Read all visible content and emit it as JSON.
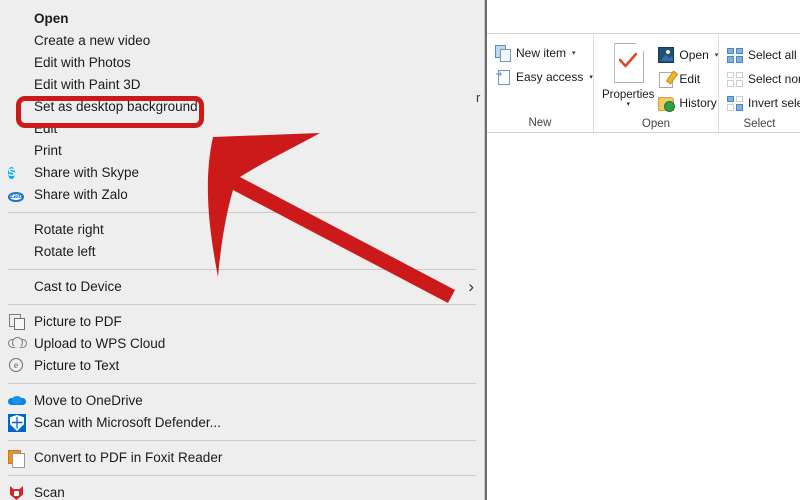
{
  "window": {
    "background_color": "#ffffff",
    "menu_background": "#eeeeee",
    "accent_red": "#cc1a1a",
    "partial_text_right_of_menu": "r"
  },
  "context_menu": {
    "name": "file-context-menu",
    "groups": [
      {
        "items": [
          {
            "label": "Open",
            "icon": "none",
            "bold": true,
            "has_submenu": false
          },
          {
            "label": "Create a new video",
            "icon": "none",
            "bold": false,
            "has_submenu": false
          },
          {
            "label": "Edit with Photos",
            "icon": "none",
            "bold": false,
            "has_submenu": false
          },
          {
            "label": "Edit with Paint 3D",
            "icon": "none",
            "bold": false,
            "has_submenu": false
          },
          {
            "label": "Set as desktop background",
            "icon": "none",
            "bold": false,
            "has_submenu": false,
            "highlighted": true
          },
          {
            "label": "Edit",
            "icon": "none",
            "bold": false,
            "has_submenu": false
          },
          {
            "label": "Print",
            "icon": "none",
            "bold": false,
            "has_submenu": false
          },
          {
            "label": "Share with Skype",
            "icon": "skype-icon",
            "bold": false,
            "has_submenu": false
          },
          {
            "label": "Share with Zalo",
            "icon": "zalo-icon",
            "bold": false,
            "has_submenu": false
          }
        ]
      },
      {
        "items": [
          {
            "label": "Rotate right",
            "icon": "none",
            "bold": false,
            "has_submenu": false
          },
          {
            "label": "Rotate left",
            "icon": "none",
            "bold": false,
            "has_submenu": false
          }
        ]
      },
      {
        "items": [
          {
            "label": "Cast to Device",
            "icon": "none",
            "bold": false,
            "has_submenu": true,
            "submenu_glyph": "›"
          }
        ]
      },
      {
        "items": [
          {
            "label": "Picture to PDF",
            "icon": "picture-to-pdf-icon",
            "bold": false,
            "has_submenu": false
          },
          {
            "label": "Upload to WPS Cloud",
            "icon": "cloud-upload-icon",
            "bold": false,
            "has_submenu": false
          },
          {
            "label": "Picture to Text",
            "icon": "picture-to-text-icon",
            "bold": false,
            "has_submenu": false
          }
        ]
      },
      {
        "items": [
          {
            "label": "Move to OneDrive",
            "icon": "onedrive-icon",
            "bold": false,
            "has_submenu": false
          },
          {
            "label": "Scan with Microsoft Defender...",
            "icon": "defender-shield-icon",
            "bold": false,
            "has_submenu": false
          }
        ]
      },
      {
        "items": [
          {
            "label": "Convert to PDF in Foxit Reader",
            "icon": "foxit-pdf-icon",
            "bold": false,
            "has_submenu": false
          }
        ]
      },
      {
        "items": [
          {
            "label": "Scan",
            "icon": "scan-shield-icon",
            "bold": false,
            "has_submenu": false
          }
        ]
      }
    ]
  },
  "ribbon": {
    "name": "explorer-home-ribbon",
    "groups": [
      {
        "label": "New",
        "commands": [
          {
            "label": "New item",
            "icon": "new-item-icon",
            "has_caret": true,
            "caret": "▾"
          },
          {
            "label": "Easy access",
            "icon": "easy-access-icon",
            "has_caret": true,
            "caret": "▾"
          }
        ]
      },
      {
        "label": "Open",
        "big_command": {
          "label": "Properties",
          "icon": "properties-icon",
          "caret": "▾"
        },
        "commands": [
          {
            "label": "Open",
            "icon": "open-image-icon",
            "has_caret": true,
            "caret": "▾"
          },
          {
            "label": "Edit",
            "icon": "edit-pencil-icon",
            "has_caret": false,
            "caret": ""
          },
          {
            "label": "History",
            "icon": "history-icon",
            "has_caret": false,
            "caret": ""
          }
        ]
      },
      {
        "label": "Select",
        "commands": [
          {
            "label": "Select all",
            "icon": "select-all-icon",
            "has_caret": false,
            "caret": ""
          },
          {
            "label": "Select none",
            "icon": "select-none-icon",
            "has_caret": false,
            "caret": ""
          },
          {
            "label": "Invert selection",
            "icon": "invert-selection-icon",
            "has_caret": false,
            "caret": ""
          }
        ]
      }
    ]
  },
  "annotation": {
    "highlight_target": "Set as desktop background",
    "highlight_color": "#cc1a1a",
    "arrow_color": "#cc1a1a",
    "arrow_direction": "up-left"
  }
}
